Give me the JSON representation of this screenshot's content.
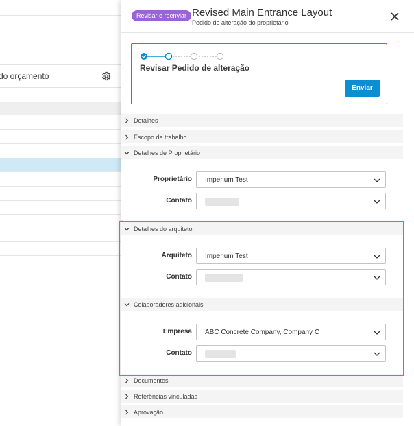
{
  "background_list": {
    "header_text": "do orçamento",
    "settings_icon": "gear-icon"
  },
  "panel": {
    "badge": "Revisar e reenviar",
    "title": "Revised Main Entrance Layout",
    "subtitle": "Pedido de alteração do proprietário",
    "close_icon": "close-icon",
    "stepper": {
      "current_step_title": "Revisar Pedido de alteração",
      "steps_total": 4,
      "steps_completed": 1,
      "submit_label": "Enviar"
    },
    "sections": {
      "detalhes": "Detalhes",
      "escopo": "Escopo de trabalho",
      "proprietario": "Detalhes de Proprietário",
      "arquiteto": "Detalhes do arquiteto",
      "colaboradores": "Colaboradores adicionais",
      "documentos": "Documentos",
      "referencias": "Referências vinculadas",
      "aprovacao": "Aprovação"
    },
    "owner": {
      "owner_label": "Proprietário",
      "owner_value": "Imperium Test",
      "contact_label": "Contato"
    },
    "architect": {
      "architect_label": "Arquiteto",
      "architect_value": "Imperium Test",
      "contact_label": "Contato"
    },
    "collaborators": {
      "company_label": "Empresa",
      "company_value": "ABC Concrete Company, Company C",
      "contact_label": "Contato"
    }
  },
  "colors": {
    "accent": "#0a8fd2",
    "badge": "#9a63d9",
    "highlight": "#e34f9d",
    "selected_row": "#cfe9f6"
  }
}
